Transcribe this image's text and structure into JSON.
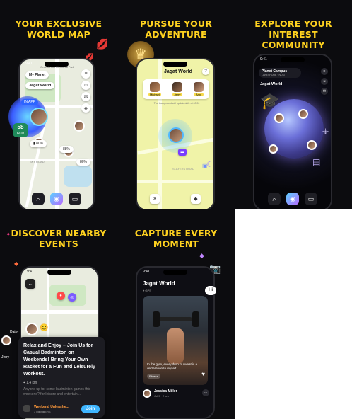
{
  "panels": {
    "world_map": {
      "headline_line1": "YOUR EXCLUSIVE",
      "headline_line2": "WORLD MAP",
      "status_time": "9:41",
      "location_chip": "Greenbrook Memorial Park",
      "planet_chip": "My Planet",
      "world_title": "Jagat World",
      "in_app_badge": "IN APP",
      "battery_value": "58",
      "battery_unit": "BATH",
      "percent_a": "80%",
      "percent_b": "88%",
      "percent_c": "80%",
      "road_label": "SKY ROAD"
    },
    "adventure": {
      "headline_line1": "PURSUE YOUR",
      "headline_line2": "ADVENTURE",
      "world_title": "Jagat World",
      "friends": [
        {
          "name": "Michael"
        },
        {
          "name": "Jerry"
        },
        {
          "name": "Amy"
        }
      ],
      "hint_text": "The background will update daily at 00:00",
      "road_label": "SLAYERS ROAD"
    },
    "community": {
      "headline_line1": "EXPLORE YOUR",
      "headline_line2": "INTEREST",
      "headline_line3": "COMMUNITY",
      "status_time": "9:41",
      "planet_name": "Planet Campus",
      "planet_sub": "LAKESHORE · NO.3",
      "world_title": "Jagat World"
    },
    "events": {
      "headline_line1": "DISCOVER NEARBY",
      "headline_line2": "EVENTS",
      "status_time": "9:41",
      "event_title": "Relax and Enjoy – Join Us for Casual Badminton on Weekends! Bring Your Own Racket for a Fun and Leisurely Workout.",
      "distance": "1.4 km",
      "event_desc": "Anyone up for some badminton games this weekend? for leisure and entertain...",
      "group_name": "Weekend Unleashe...",
      "members": "3 MEMBERS",
      "join_label": "Join",
      "user_a": "Daisy",
      "user_b": "Jerry"
    },
    "moment": {
      "headline_line1": "CAPTURE EVERY",
      "headline_line2": "MOMENT",
      "status_time": "9:41",
      "world_title": "Jagat World",
      "world_sub": "GPS",
      "hi_bubble": "Hi",
      "caption": "In the gym, every drop of sweat is a declaration to myself",
      "tag": "Fitness",
      "user_name": "Jessica Miller",
      "user_time": "Jul 9 · 2 km"
    }
  },
  "colors": {
    "panel_bg": "#0c0c0f",
    "headline_yellow": "#ffd21f",
    "headline_pink": "#f5c9ff",
    "join_blue": "#3fb6ff",
    "map_bg": "#e9ecdf",
    "adventure_map": "#f0f3a8"
  }
}
